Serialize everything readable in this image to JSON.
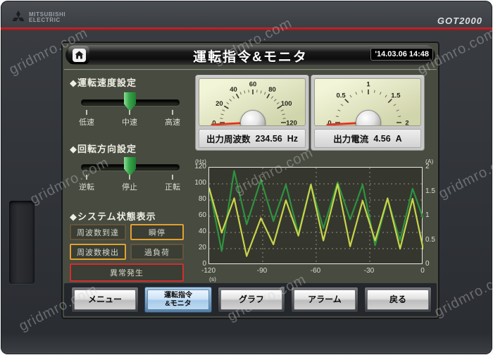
{
  "watermark": {
    "text": "gridmro.com"
  },
  "device": {
    "brand_top": "MITSUBISHI",
    "brand_bottom": "ELECTRIC",
    "model": "GOT2000"
  },
  "header": {
    "title": "運転指令&モニタ",
    "clock": "'14.03.06 14:48"
  },
  "controls": {
    "speed": {
      "title": "◆運転速度設定",
      "options": [
        "低速",
        "中速",
        "高速"
      ],
      "selected": "中速"
    },
    "direction": {
      "title": "◆回転方向設定",
      "options": [
        "逆転",
        "停止",
        "正転"
      ],
      "selected": "停止"
    }
  },
  "status": {
    "title": "◆システム状態表示",
    "indicators": [
      {
        "label": "周波数到達",
        "state": "off"
      },
      {
        "label": "瞬停",
        "state": "on"
      },
      {
        "label": "周波数検出",
        "state": "on"
      },
      {
        "label": "過負荷",
        "state": "off"
      },
      {
        "label": "異常発生",
        "state": "alarm"
      }
    ]
  },
  "gauges": [
    {
      "name": "出力周波数",
      "value": "234.56",
      "unit": "Hz",
      "min": 0,
      "max": 120,
      "ticks": [
        0,
        20,
        40,
        60,
        80,
        100,
        120
      ],
      "needle_value": 0
    },
    {
      "name": "出力電流",
      "value": "4.56",
      "unit": "A",
      "min": 0,
      "max": 2,
      "ticks": [
        0,
        0.5,
        1,
        1.5,
        2
      ],
      "needle_value": 0
    }
  ],
  "chart_data": {
    "type": "line",
    "title": "",
    "grid": "dashed",
    "left_axis": {
      "label": "(Hz)",
      "range": [
        0,
        120
      ],
      "ticks": [
        0,
        20,
        40,
        60,
        80,
        100,
        120
      ]
    },
    "right_axis": {
      "label": "(A)",
      "range": [
        0,
        2
      ],
      "ticks": [
        0,
        0.5,
        1,
        1.5,
        2
      ]
    },
    "x_axis": {
      "label": "(s)",
      "range": [
        -120,
        0
      ],
      "ticks": [
        -120,
        -90,
        -60,
        -30,
        0
      ]
    },
    "series": [
      {
        "name": "出力周波数",
        "axis": "left",
        "color": "#2f9240",
        "points": [
          [
            -120,
            96
          ],
          [
            -113,
            17
          ],
          [
            -106,
            116
          ],
          [
            -99,
            50
          ],
          [
            -91,
            105
          ],
          [
            -84,
            54
          ],
          [
            -77,
            99
          ],
          [
            -70,
            38
          ],
          [
            -63,
            99
          ],
          [
            -56,
            45
          ],
          [
            -48,
            102
          ],
          [
            -41,
            56
          ],
          [
            -34,
            99
          ],
          [
            -27,
            24
          ],
          [
            -20,
            81
          ],
          [
            -13,
            30
          ],
          [
            -6,
            94
          ],
          [
            0,
            57
          ]
        ]
      },
      {
        "name": "出力電流",
        "axis": "right",
        "color": "#c9d44a",
        "points": [
          [
            -120,
            1.58
          ],
          [
            -113,
            0.66
          ],
          [
            -106,
            1.37
          ],
          [
            -99,
            0.18
          ],
          [
            -91,
            0.96
          ],
          [
            -84,
            0.42
          ],
          [
            -77,
            1.33
          ],
          [
            -70,
            0.6
          ],
          [
            -63,
            1.65
          ],
          [
            -56,
            0.5
          ],
          [
            -48,
            1.66
          ],
          [
            -41,
            0.38
          ],
          [
            -34,
            1.32
          ],
          [
            -27,
            0.5
          ],
          [
            -20,
            1.37
          ],
          [
            -13,
            0.33
          ],
          [
            -6,
            1.36
          ],
          [
            0,
            0.32
          ]
        ]
      }
    ]
  },
  "nav": {
    "buttons": [
      {
        "label": "メニュー",
        "active": false
      },
      {
        "label": "運転指令\n&モニタ",
        "active": true
      },
      {
        "label": "グラフ",
        "active": false
      },
      {
        "label": "アラーム",
        "active": false
      },
      {
        "label": "戻る",
        "active": false
      }
    ]
  }
}
